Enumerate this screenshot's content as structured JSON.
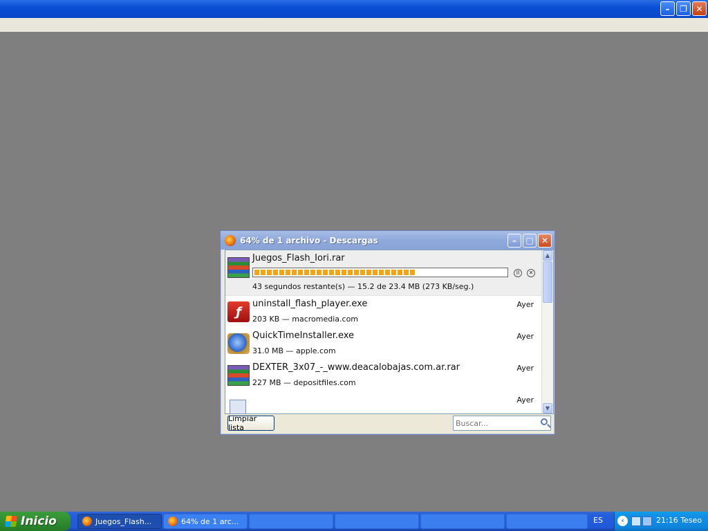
{
  "downloads_window": {
    "title": "64% de 1 archivo - Descargas",
    "items": [
      {
        "name": "Juegos_Flash_Iori.rar",
        "status": "43 segundos restante(s) — 15.2 de 23.4 MB (273 KB/seg.)",
        "progress": 0.64,
        "icon": "winrar-archive-icon"
      },
      {
        "name": "uninstall_flash_player.exe",
        "status": "203 KB — macromedia.com",
        "date": "Ayer",
        "icon": "flash-icon"
      },
      {
        "name": "QuickTimeInstaller.exe",
        "status": "31.0 MB — apple.com",
        "date": "Ayer",
        "icon": "quicktime-icon"
      },
      {
        "name": "DEXTER_3x07_-_www.deacalobajas.com.ar.rar",
        "status": "227 MB — depositfiles.com",
        "date": "Ayer",
        "icon": "winrar-archive-icon"
      },
      {
        "name": "",
        "status": "",
        "date": "Ayer",
        "icon": "video-file-icon"
      }
    ],
    "clear_button": "Limpiar lista",
    "search_placeholder": "Buscar..."
  },
  "taskbar": {
    "start_label": "Inicio",
    "tasks": [
      "Juegos_Flash...",
      "64% de 1 arc..."
    ],
    "language": "ES",
    "clock": "21:16 Teseo"
  }
}
